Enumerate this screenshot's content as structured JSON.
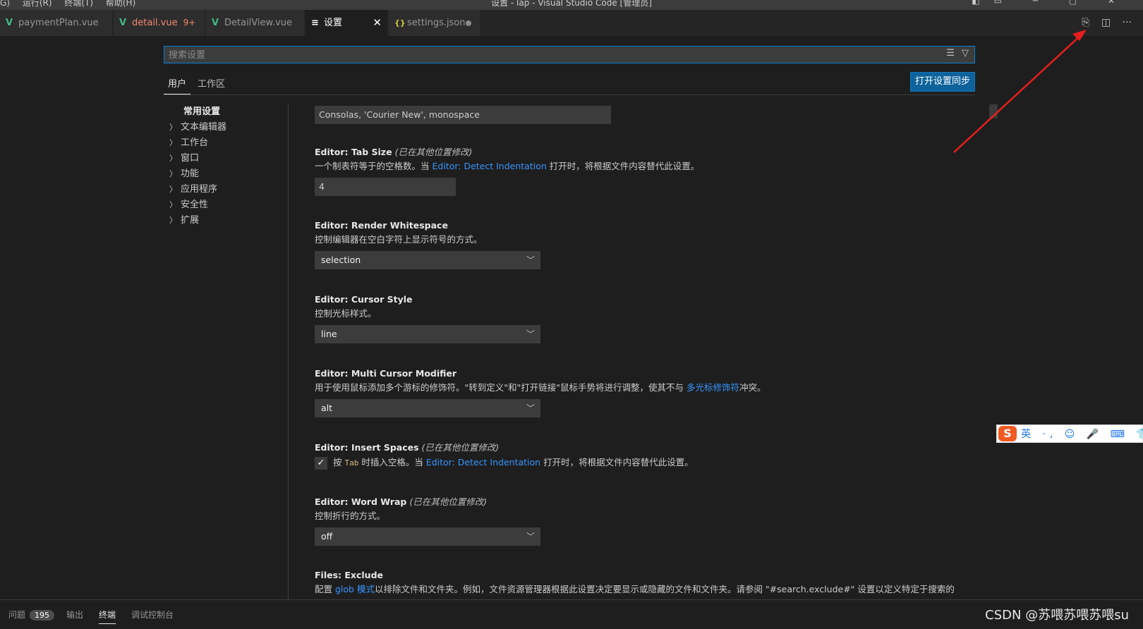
{
  "titlebar": {
    "menu": [
      "G)",
      "运行(R)",
      "终端(T)",
      "帮助(H)"
    ],
    "title": "设置 - lap - Visual Studio Code [管理员]"
  },
  "tabs": [
    {
      "label": "paymentPlan.vue",
      "icon": "vue-icon"
    },
    {
      "label": "detail.vue",
      "count": "9+",
      "icon": "vue-icon"
    },
    {
      "label": "DetailView.vue",
      "icon": "vue-icon"
    },
    {
      "label": "设置",
      "icon": "settings-icon",
      "close": "✕"
    },
    {
      "label": "settings.json",
      "icon": "json-icon"
    }
  ],
  "editor_actions": [
    "open-settings-json-icon",
    "split-editor-icon",
    "more-actions-icon"
  ],
  "search": {
    "placeholder": "搜索设置",
    "value": ""
  },
  "scope_tabs": {
    "user": "用户",
    "workspace": "工作区"
  },
  "sync_button": "打开设置同步",
  "toc": {
    "header": "常用设置",
    "items": [
      "文本编辑器",
      "工作台",
      "窗口",
      "功能",
      "应用程序",
      "安全性",
      "扩展"
    ]
  },
  "settings": {
    "font_family": {
      "value": "Consolas, 'Courier New', monospace"
    },
    "tab_size": {
      "category": "Editor: ",
      "name": "Tab Size",
      "modified": "(已在其他位置修改)",
      "desc_pre": "一个制表符等于的空格数。当 ",
      "desc_link": "Editor: Detect Indentation",
      "desc_post": " 打开时，将根据文件内容替代此设置。",
      "value": "4"
    },
    "render_whitespace": {
      "category": "Editor: ",
      "name": "Render Whitespace",
      "desc": "控制编辑器在空白字符上显示符号的方式。",
      "value": "selection"
    },
    "cursor_style": {
      "category": "Editor: ",
      "name": "Cursor Style",
      "desc": "控制光标样式。",
      "value": "line"
    },
    "multi_cursor": {
      "category": "Editor: ",
      "name": "Multi Cursor Modifier",
      "desc_pre": "用于使用鼠标添加多个游标的修饰符。\"转到定义\"和\"打开链接\"鼠标手势将进行调整，使其不与 ",
      "desc_link": "多光标修饰符",
      "desc_post": "冲突。",
      "value": "alt"
    },
    "insert_spaces": {
      "category": "Editor: ",
      "name": "Insert Spaces",
      "modified": "(已在其他位置修改)",
      "checked": true,
      "check_glyph": "✓",
      "desc_pre": "按 ",
      "desc_kbd": "Tab",
      "desc_mid": " 时插入空格。当 ",
      "desc_link": "Editor: Detect Indentation",
      "desc_post": " 打开时，将根据文件内容替代此设置。"
    },
    "word_wrap": {
      "category": "Editor: ",
      "name": "Word Wrap",
      "modified": "(已在其他位置修改)",
      "desc": "控制折行的方式。",
      "value": "off"
    },
    "files_exclude": {
      "category": "Files: ",
      "name": "Exclude",
      "desc_pre": "配置 ",
      "desc_link": "glob 模式",
      "desc_post": "以排除文件和文件夹。例如，文件资源管理器根据此设置决定要显示或隐藏的文件和文件夹。请参阅 \"#search.exclude#\" 设置以定义特定于搜索的"
    }
  },
  "panel": {
    "problems": "问题",
    "problems_count": "195",
    "output": "输出",
    "terminal": "终端",
    "debug_console": "调试控制台"
  },
  "ime": {
    "logo": "S",
    "items": "英 ·, ☺ 🎤 ⌨ 👕 ▦"
  },
  "watermark": "CSDN @苏喂苏喂苏喂su",
  "colors": {
    "accent": "#007fd4",
    "button": "#0e639c",
    "link": "#3794ff",
    "arrow": "#e81e1e"
  }
}
